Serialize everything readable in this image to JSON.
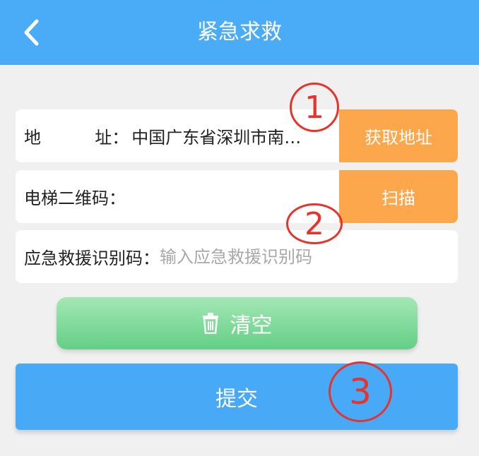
{
  "header": {
    "title": "紧急求救",
    "back_icon": "chevron-left-icon"
  },
  "form": {
    "address": {
      "label": "地          址：",
      "value": "中国广东省深圳市南…",
      "button": "获取地址"
    },
    "elevator_qr": {
      "label": "电梯二维码：",
      "value": "",
      "button": "扫描"
    },
    "rescue_code": {
      "label": "应急救援识别码：",
      "placeholder": "输入应急救援识别码",
      "value": ""
    }
  },
  "clear_button": {
    "label": "清空",
    "icon": "trash-icon"
  },
  "submit_button": {
    "label": "提交"
  },
  "markers": [
    "1",
    "2",
    "3"
  ],
  "colors": {
    "header": "#4aabf7",
    "orange_button": "#fca74b",
    "clear_button": "#63cf84",
    "submit_button": "#48aaf7",
    "marker": "#e8322c"
  }
}
